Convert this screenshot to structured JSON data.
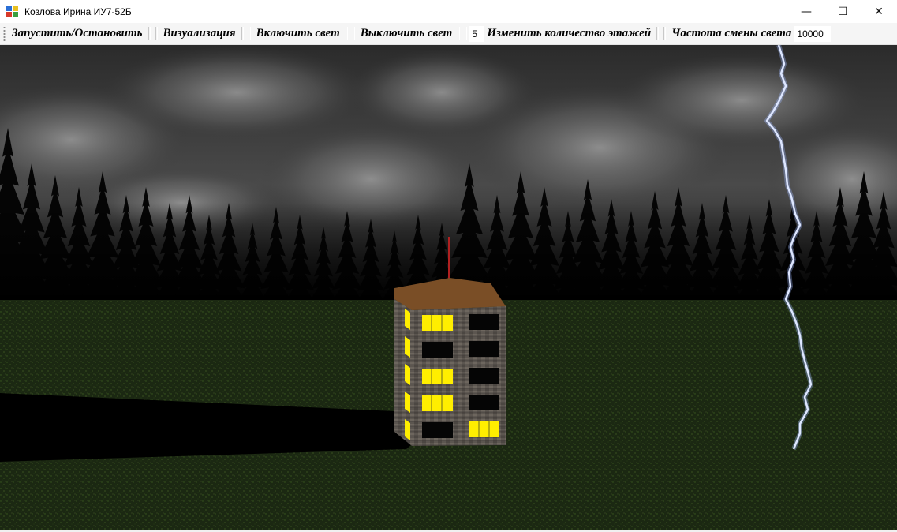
{
  "window": {
    "title": "Козлова Ирина ИУ7-52Б",
    "minimize_glyph": "—",
    "maximize_glyph": "☐",
    "close_glyph": "✕"
  },
  "toolbar": {
    "start_stop_label": "Запустить/Остановить",
    "visualize_label": "Визуализация",
    "light_on_label": "Включить свет",
    "light_off_label": "Выключить свет",
    "floors_value": "5",
    "change_floors_label": "Изменить количество этажей",
    "frequency_label": "Частота смены света",
    "frequency_value": "10000"
  },
  "scene": {
    "floors": 5,
    "lit_windows": {
      "side": [
        true,
        true,
        true,
        true,
        true
      ],
      "front_left": [
        true,
        false,
        true,
        true,
        false
      ],
      "front_right": [
        false,
        false,
        false,
        false,
        true
      ]
    },
    "colors": {
      "sky": "#3c3c3c",
      "ground": "#1d2a12",
      "wall": "#5a5550",
      "roof": "#7a4e26",
      "lit_window": "#ffee00",
      "dark_window": "#050505",
      "lightning": "#ffffff",
      "antenna": "#b02020"
    }
  }
}
